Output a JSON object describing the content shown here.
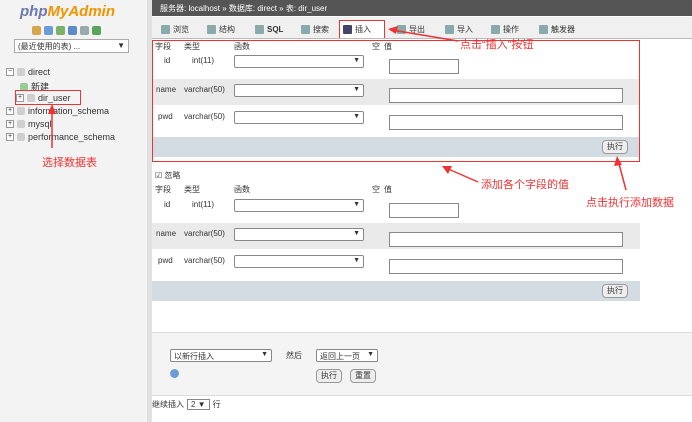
{
  "logo": {
    "php": "php",
    "myadmin": "MyAdmin"
  },
  "recent": {
    "label": "(最近使用的表) ..."
  },
  "tree": {
    "direct": "direct",
    "new": "新建",
    "dir_user": "dir_user",
    "info": "information_schema",
    "mysql": "mysql",
    "perf": "performance_schema"
  },
  "breadcrumb": "服务器: localhost » 数据库: direct » 表: dir_user",
  "tabs": [
    "浏览",
    "结构",
    "SQL",
    "搜索",
    "插入",
    "导出",
    "导入",
    "操作",
    "触发器"
  ],
  "headers": {
    "field": "字段",
    "type": "类型",
    "func": "函数",
    "null": "空",
    "value": "值"
  },
  "rows": [
    {
      "field": "id",
      "type": "int(11)"
    },
    {
      "field": "name",
      "type": "varchar(50)"
    },
    {
      "field": "pwd",
      "type": "varchar(50)"
    }
  ],
  "ignore": "忽略",
  "exec": "执行",
  "bottom": {
    "insert_as": "以新行插入",
    "then": "然后",
    "goback": "返回上一页",
    "exec": "执行",
    "reset": "重置"
  },
  "continue": {
    "label": "继续插入",
    "count": "2",
    "suffix": "行"
  },
  "annotations": {
    "click_insert": "点击“插入”按钮",
    "select_table": "选择数据表",
    "add_values": "添加各个字段的值",
    "click_exec": "点击执行添加数据"
  }
}
